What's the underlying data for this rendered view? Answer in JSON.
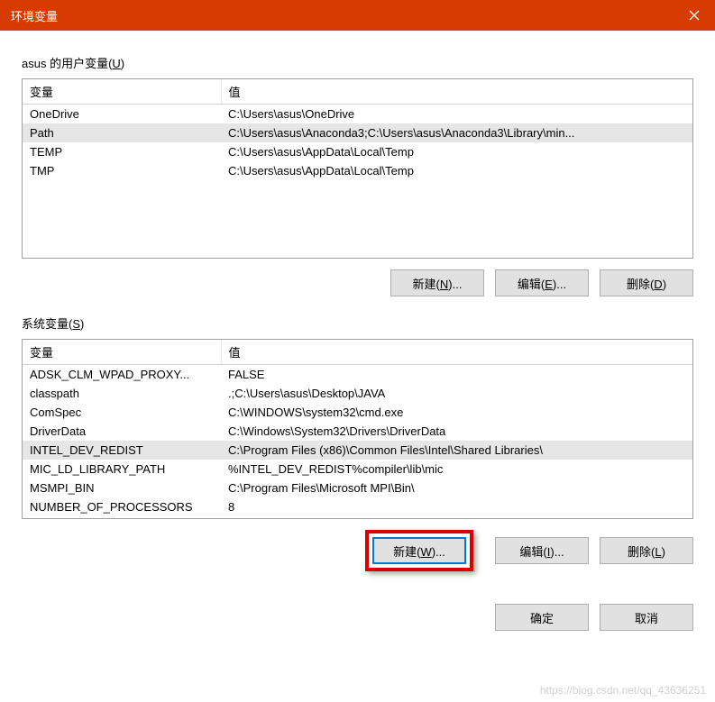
{
  "titlebar": {
    "title": "环境变量"
  },
  "user_section": {
    "label_prefix": "asus 的用户变量(",
    "label_mnemonic": "U",
    "label_suffix": ")",
    "col_var": "变量",
    "col_val": "值",
    "rows": [
      {
        "name": "OneDrive",
        "value": "C:\\Users\\asus\\OneDrive",
        "selected": false
      },
      {
        "name": "Path",
        "value": "C:\\Users\\asus\\Anaconda3;C:\\Users\\asus\\Anaconda3\\Library\\min...",
        "selected": true
      },
      {
        "name": "TEMP",
        "value": "C:\\Users\\asus\\AppData\\Local\\Temp",
        "selected": false
      },
      {
        "name": "TMP",
        "value": "C:\\Users\\asus\\AppData\\Local\\Temp",
        "selected": false
      }
    ],
    "btn_new_prefix": "新建(",
    "btn_new_m": "N",
    "btn_new_suffix": ")...",
    "btn_edit_prefix": "编辑(",
    "btn_edit_m": "E",
    "btn_edit_suffix": ")...",
    "btn_del_prefix": "删除(",
    "btn_del_m": "D",
    "btn_del_suffix": ")"
  },
  "sys_section": {
    "label_prefix": "系统变量(",
    "label_mnemonic": "S",
    "label_suffix": ")",
    "col_var": "变量",
    "col_val": "值",
    "rows": [
      {
        "name": "ADSK_CLM_WPAD_PROXY...",
        "value": "FALSE",
        "selected": false
      },
      {
        "name": "classpath",
        "value": ".;C:\\Users\\asus\\Desktop\\JAVA",
        "selected": false
      },
      {
        "name": "ComSpec",
        "value": "C:\\WINDOWS\\system32\\cmd.exe",
        "selected": false
      },
      {
        "name": "DriverData",
        "value": "C:\\Windows\\System32\\Drivers\\DriverData",
        "selected": false
      },
      {
        "name": "INTEL_DEV_REDIST",
        "value": "C:\\Program Files (x86)\\Common Files\\Intel\\Shared Libraries\\",
        "selected": true
      },
      {
        "name": "MIC_LD_LIBRARY_PATH",
        "value": "%INTEL_DEV_REDIST%compiler\\lib\\mic",
        "selected": false
      },
      {
        "name": "MSMPI_BIN",
        "value": "C:\\Program Files\\Microsoft MPI\\Bin\\",
        "selected": false
      },
      {
        "name": "NUMBER_OF_PROCESSORS",
        "value": "8",
        "selected": false
      }
    ],
    "btn_new_prefix": "新建(",
    "btn_new_m": "W",
    "btn_new_suffix": ")...",
    "btn_edit_prefix": "编辑(",
    "btn_edit_m": "I",
    "btn_edit_suffix": ")...",
    "btn_del_prefix": "删除(",
    "btn_del_m": "L",
    "btn_del_suffix": ")"
  },
  "footer": {
    "ok": "确定",
    "cancel": "取消"
  },
  "watermark": "https://blog.csdn.net/qq_43636251"
}
